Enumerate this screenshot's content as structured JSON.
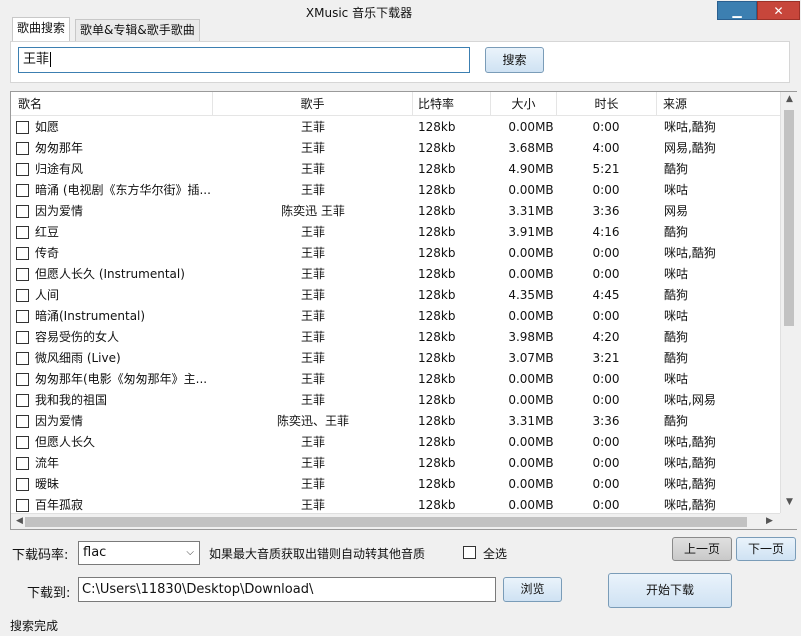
{
  "window": {
    "title": "XMusic 音乐下载器",
    "minimize_label": "▁",
    "close_label": "✕"
  },
  "tabs": [
    {
      "label": "歌曲搜索",
      "active": true
    },
    {
      "label": "歌单&专辑&歌手歌曲",
      "active": false
    }
  ],
  "search": {
    "value": "王菲",
    "button_label": "搜索"
  },
  "table": {
    "columns": [
      "歌名",
      "歌手",
      "比特率",
      "大小",
      "时长",
      "来源"
    ],
    "rows": [
      {
        "name": "如愿",
        "artist": "王菲",
        "bitrate": "128kb",
        "size": "0.00MB",
        "duration": "0:00",
        "source": "咪咕,酷狗"
      },
      {
        "name": "匆匆那年",
        "artist": "王菲",
        "bitrate": "128kb",
        "size": "3.68MB",
        "duration": "4:00",
        "source": "网易,酷狗"
      },
      {
        "name": "归途有风",
        "artist": "王菲",
        "bitrate": "128kb",
        "size": "4.90MB",
        "duration": "5:21",
        "source": "酷狗"
      },
      {
        "name": "暗涌 (电视剧《东方华尔街》插...",
        "artist": "王菲",
        "bitrate": "128kb",
        "size": "0.00MB",
        "duration": "0:00",
        "source": "咪咕"
      },
      {
        "name": "因为爱情",
        "artist": "陈奕迅 王菲",
        "bitrate": "128kb",
        "size": "3.31MB",
        "duration": "3:36",
        "source": "网易"
      },
      {
        "name": "红豆",
        "artist": "王菲",
        "bitrate": "128kb",
        "size": "3.91MB",
        "duration": "4:16",
        "source": "酷狗"
      },
      {
        "name": "传奇",
        "artist": "王菲",
        "bitrate": "128kb",
        "size": "0.00MB",
        "duration": "0:00",
        "source": "咪咕,酷狗"
      },
      {
        "name": "但愿人长久 (Instrumental)",
        "artist": "王菲",
        "bitrate": "128kb",
        "size": "0.00MB",
        "duration": "0:00",
        "source": "咪咕"
      },
      {
        "name": "人间",
        "artist": "王菲",
        "bitrate": "128kb",
        "size": "4.35MB",
        "duration": "4:45",
        "source": "酷狗"
      },
      {
        "name": "暗涌(Instrumental)",
        "artist": "王菲",
        "bitrate": "128kb",
        "size": "0.00MB",
        "duration": "0:00",
        "source": "咪咕"
      },
      {
        "name": "容易受伤的女人",
        "artist": "王菲",
        "bitrate": "128kb",
        "size": "3.98MB",
        "duration": "4:20",
        "source": "酷狗"
      },
      {
        "name": "微风细雨 (Live)",
        "artist": "王菲",
        "bitrate": "128kb",
        "size": "3.07MB",
        "duration": "3:21",
        "source": "酷狗"
      },
      {
        "name": "匆匆那年(电影《匆匆那年》主...",
        "artist": "王菲",
        "bitrate": "128kb",
        "size": "0.00MB",
        "duration": "0:00",
        "source": "咪咕"
      },
      {
        "name": "我和我的祖国",
        "artist": "王菲",
        "bitrate": "128kb",
        "size": "0.00MB",
        "duration": "0:00",
        "source": "咪咕,网易"
      },
      {
        "name": "因为爱情",
        "artist": "陈奕迅、王菲",
        "bitrate": "128kb",
        "size": "3.31MB",
        "duration": "3:36",
        "source": "酷狗"
      },
      {
        "name": "但愿人长久",
        "artist": "王菲",
        "bitrate": "128kb",
        "size": "0.00MB",
        "duration": "0:00",
        "source": "咪咕,酷狗"
      },
      {
        "name": "流年",
        "artist": "王菲",
        "bitrate": "128kb",
        "size": "0.00MB",
        "duration": "0:00",
        "source": "咪咕,酷狗"
      },
      {
        "name": "暧昧",
        "artist": "王菲",
        "bitrate": "128kb",
        "size": "0.00MB",
        "duration": "0:00",
        "source": "咪咕,酷狗"
      },
      {
        "name": "百年孤寂",
        "artist": "王菲",
        "bitrate": "128kb",
        "size": "0.00MB",
        "duration": "0:00",
        "source": "咪咕,酷狗"
      }
    ]
  },
  "scroll": {
    "up": "▲",
    "down": "▼",
    "left": "◀",
    "right": "▶"
  },
  "controls": {
    "bitrate_label": "下载码率:",
    "bitrate_value": "flac",
    "dropdown_arrow": "⌵",
    "fallback_note": "如果最大音质获取出错则自动转其他音质",
    "select_all_label": "全选",
    "prev_page": "上一页",
    "next_page": "下一页",
    "download_to_label": "下载到:",
    "download_path": "C:\\Users\\11830\\Desktop\\Download\\",
    "browse_label": "浏览",
    "start_download_label": "开始下载"
  },
  "status": "搜索完成"
}
